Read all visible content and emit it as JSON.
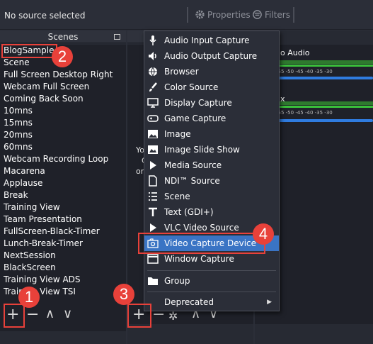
{
  "topbar": {
    "no_source": "No source selected",
    "properties": "Properties",
    "filters": "Filters"
  },
  "scenes": {
    "header": "Scenes",
    "items": [
      "BlogSample",
      "Scene",
      "Full Screen Desktop Right",
      "Webcam Full Screen",
      "Coming Back Soon",
      "10mns",
      "15mns",
      "20mns",
      "60mns",
      "Webcam Recording Loop",
      "Macarena",
      "Applause",
      "Break",
      "Training View",
      "Team Presentation",
      "FullScreen-Black-Timer",
      "Lunch-Break-Timer",
      "NextSession",
      "BlackScreen",
      "Training View ADS",
      "Training View TSI"
    ]
  },
  "sources": {
    "hint_lines": [
      "Yo",
      "C",
      "or"
    ]
  },
  "mixer": {
    "track1": "o Audio",
    "track2": "x",
    "ticks": "-55   -50   -45   -40   -35   -30"
  },
  "menu": {
    "items": [
      {
        "label": "Audio Input Capture",
        "icon": "microphone-icon"
      },
      {
        "label": "Audio Output Capture",
        "icon": "speaker-icon"
      },
      {
        "label": "Browser",
        "icon": "globe-icon"
      },
      {
        "label": "Color Source",
        "icon": "brush-icon"
      },
      {
        "label": "Display Capture",
        "icon": "monitor-icon"
      },
      {
        "label": "Game Capture",
        "icon": "gamepad-icon"
      },
      {
        "label": "Image",
        "icon": "image-icon"
      },
      {
        "label": "Image Slide Show",
        "icon": "slideshow-icon"
      },
      {
        "label": "Media Source",
        "icon": "play-icon"
      },
      {
        "label": "NDI™ Source",
        "icon": "file-icon"
      },
      {
        "label": "Scene",
        "icon": "list-icon"
      },
      {
        "label": "Text (GDI+)",
        "icon": "text-icon"
      },
      {
        "label": "VLC Video Source",
        "icon": "play-icon"
      },
      {
        "label": "Video Capture Device",
        "icon": "camera-icon"
      },
      {
        "label": "Window Capture",
        "icon": "window-icon"
      }
    ],
    "group": "Group",
    "deprecated": "Deprecated"
  },
  "callouts": [
    "1",
    "2",
    "3",
    "4"
  ],
  "colors": {
    "accent": "#3a74c4",
    "callout": "#e8413a"
  }
}
